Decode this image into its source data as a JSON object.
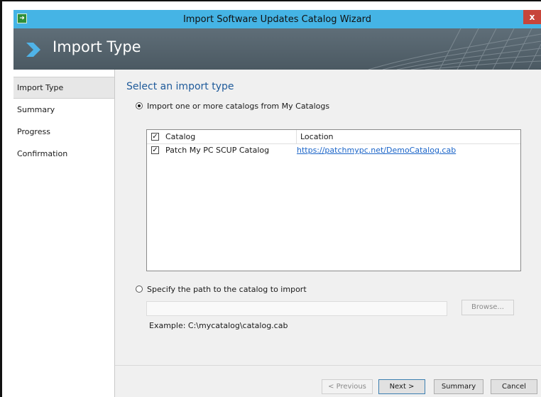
{
  "window": {
    "title": "Import Software Updates Catalog Wizard",
    "close_glyph": "x",
    "accent": "#45b4e5"
  },
  "banner": {
    "title": "Import Type",
    "icon": "arrow-icon"
  },
  "sidebar": {
    "items": [
      {
        "label": "Import Type",
        "active": true
      },
      {
        "label": "Summary",
        "active": false
      },
      {
        "label": "Progress",
        "active": false
      },
      {
        "label": "Confirmation",
        "active": false
      }
    ]
  },
  "main": {
    "heading": "Select an import type",
    "option_catalogs": {
      "label": "Import one or more catalogs from My Catalogs",
      "selected": true
    },
    "table": {
      "columns": [
        "Catalog",
        "Location"
      ],
      "header_checked": true,
      "rows": [
        {
          "checked": true,
          "catalog": "Patch My PC SCUP Catalog",
          "location": "https://patchmypc.net/DemoCatalog.cab"
        }
      ]
    },
    "option_path": {
      "label": "Specify the path to the catalog to import",
      "selected": false
    },
    "path_value": "",
    "browse_label": "Browse...",
    "example": "Example: C:\\mycatalog\\catalog.cab"
  },
  "footer": {
    "previous_label": "< Previous",
    "next_label": "Next >",
    "summary_label": "Summary",
    "cancel_label": "Cancel"
  }
}
